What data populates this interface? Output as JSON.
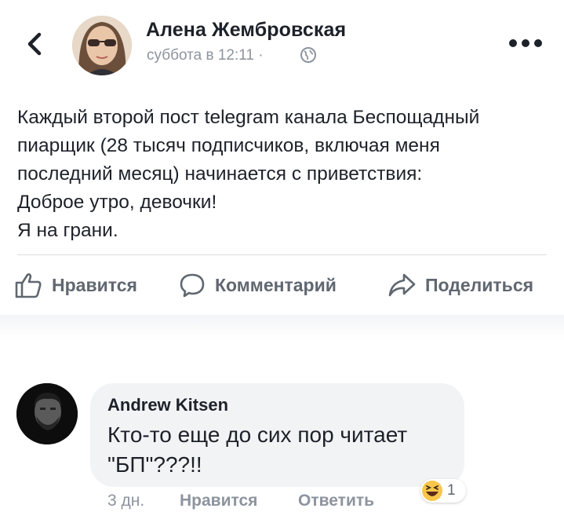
{
  "post": {
    "author": "Алена Жембровская",
    "time": "суббота в 12:11 ·",
    "text_lines": [
      "Каждый второй пост telegram канала Беспощадный",
      "пиарщик (28 тысяч подписчиков, включая меня",
      "последний месяц) начинается с приветствия:",
      "Доброе утро, девочки!",
      "Я на грани."
    ]
  },
  "actions": {
    "like": "Нравится",
    "comment": "Комментарий",
    "share": "Поделиться"
  },
  "comment": {
    "author": "Andrew Kitsen",
    "text_lines": [
      "Кто-то еще до сих пор читает",
      "\"БП\"???!!"
    ],
    "time": "3 дн.",
    "like": "Нравится",
    "reply": "Ответить",
    "reaction_count": "1"
  },
  "icons": {
    "back": "chevron-left-icon",
    "globe": "globe-icon",
    "more": "more-dots-icon",
    "like": "thumbs-up-icon",
    "comment": "speech-bubble-icon",
    "share": "share-arrow-icon",
    "reaction": "laughing-emoji-icon"
  },
  "colors": {
    "text": "#1d2129",
    "muted": "#8d949e",
    "action": "#606770",
    "bubble": "#f2f3f5",
    "divider": "#dadde1"
  }
}
